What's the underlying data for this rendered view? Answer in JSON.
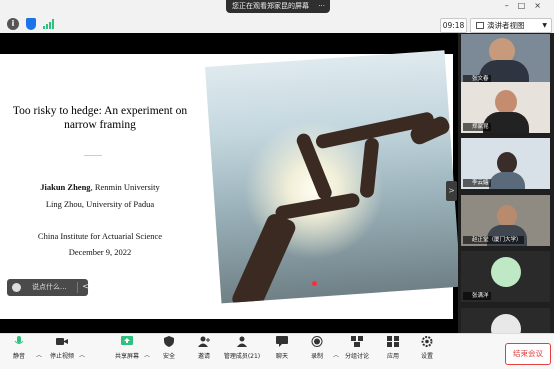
{
  "topbar": {
    "banner_text": "您正在观看郑家昆的屏幕",
    "banner_more": "···",
    "time": "09:18",
    "view_label": "演讲者视图",
    "window_controls": "–□×",
    "icons": [
      "info-icon",
      "shield-icon",
      "signal-icon"
    ]
  },
  "slide": {
    "title": "Too risky to hedge: An experiment on narrow framing",
    "author1_name": "Jiakun Zheng",
    "author1_rest": ", Renmin University",
    "author2": "Ling Zhou, University of Padua",
    "venue": "China Institute for Actuarial Science",
    "date": "December 9, 2022"
  },
  "chat_prompt": {
    "placeholder": "说点什么...",
    "arrow": "<"
  },
  "collapse_arrow": ">",
  "participants": [
    {
      "name": "张文春"
    },
    {
      "name": "郑家昆"
    },
    {
      "name": "李云嫱"
    },
    {
      "name": "赵正堂（厦门大学）"
    },
    {
      "name": "张满洋"
    },
    {
      "name": ""
    }
  ],
  "toolbar": {
    "items": [
      {
        "label": "静音",
        "icon": "mic-icon"
      },
      {
        "label": "停止视频",
        "icon": "video-icon"
      },
      {
        "label": "共享屏幕",
        "icon": "share-screen-icon"
      },
      {
        "label": "安全",
        "icon": "shield-icon"
      },
      {
        "label": "邀请",
        "icon": "invite-icon"
      },
      {
        "label": "管理成员(21)",
        "icon": "members-icon"
      },
      {
        "label": "聊天",
        "icon": "chat-icon"
      },
      {
        "label": "录制",
        "icon": "record-icon"
      },
      {
        "label": "分组讨论",
        "icon": "breakout-icon"
      },
      {
        "label": "应用",
        "icon": "apps-icon"
      },
      {
        "label": "设置",
        "icon": "settings-icon"
      }
    ],
    "end_meeting": "结束会议"
  },
  "colors": {
    "accent": "#2ec27e",
    "end": "#e53e3e",
    "share": "#2ec27e"
  }
}
